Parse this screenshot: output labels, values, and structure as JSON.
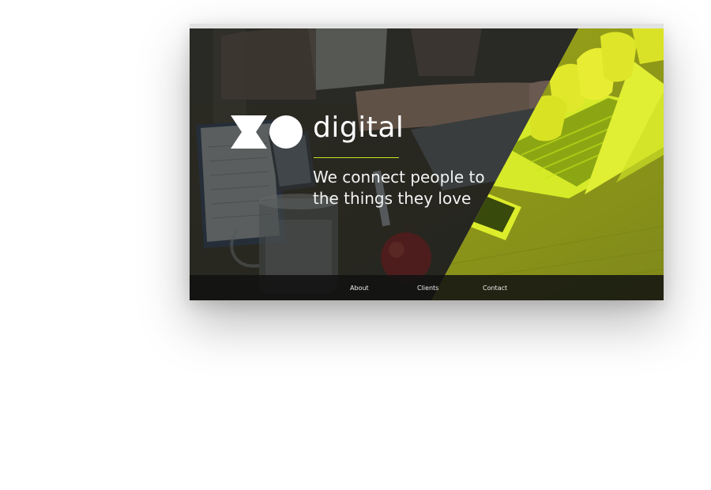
{
  "brand": {
    "name": "digital",
    "accent_color": "#d7e81f"
  },
  "hero": {
    "tagline_line1": "We connect people to",
    "tagline_line2": "the things they love",
    "photo_description_icon": "workspace-photo"
  },
  "nav": {
    "items": [
      {
        "label": "About"
      },
      {
        "label": "Clients"
      },
      {
        "label": "Contact"
      }
    ]
  },
  "colors": {
    "overlay_dark": "#262a27",
    "overlay_yellow": "#d7e81f",
    "nav_bar": "#121212"
  }
}
